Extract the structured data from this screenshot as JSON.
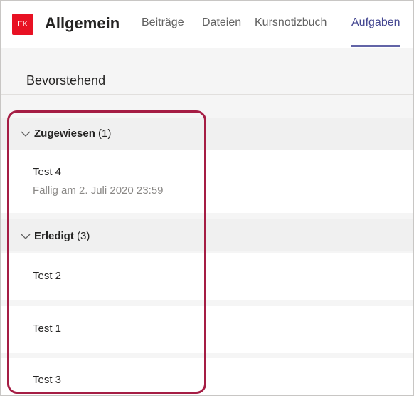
{
  "team": {
    "initials": "FK",
    "name": "Allgemein"
  },
  "tabs": [
    {
      "label": "Beiträge"
    },
    {
      "label": "Dateien"
    },
    {
      "label": "Kursnotizbuch"
    },
    {
      "label": "Aufgaben",
      "active": true
    }
  ],
  "subheader": {
    "title": "Bevorstehend"
  },
  "sections": [
    {
      "label": "Zugewiesen",
      "count": "(1)",
      "items": [
        {
          "title": "Test 4",
          "due": "Fällig am 2. Juli 2020 23:59"
        }
      ]
    },
    {
      "label": "Erledigt",
      "count": "(3)",
      "items": [
        {
          "title": "Test 2"
        },
        {
          "title": "Test 1"
        },
        {
          "title": "Test 3"
        }
      ]
    }
  ],
  "colors": {
    "avatar": "#e81123",
    "active_tab": "#444791",
    "tab_underline": "#6264a7",
    "highlight_border": "#a51d44"
  }
}
